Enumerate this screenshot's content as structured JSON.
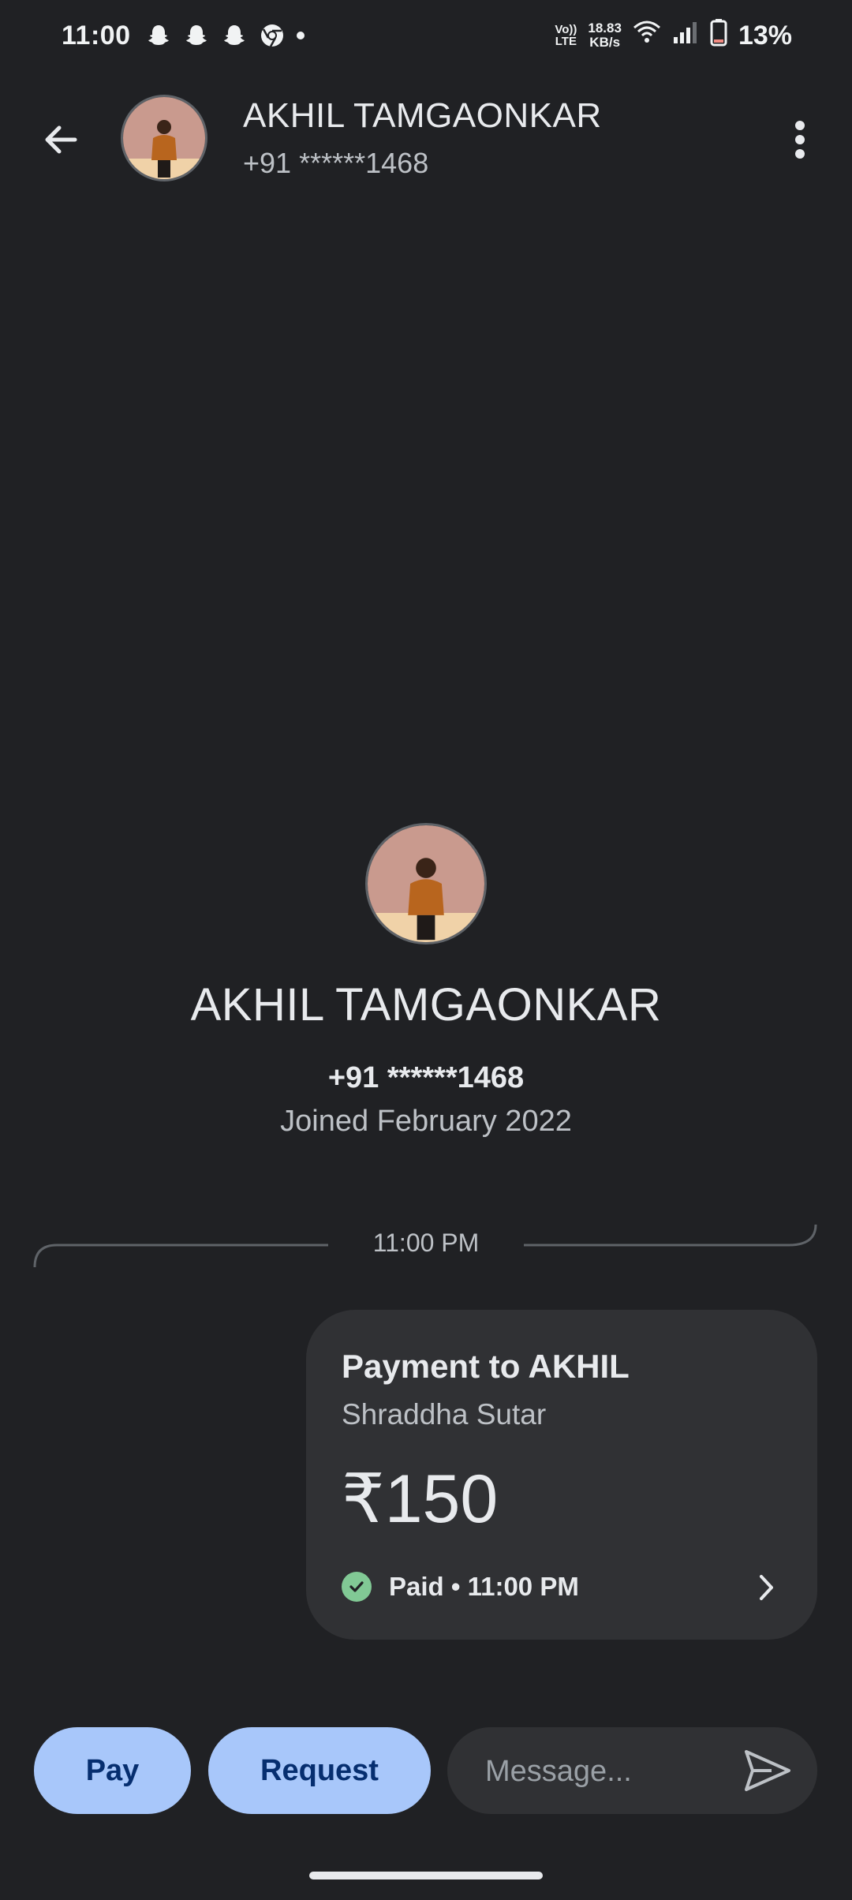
{
  "status_bar": {
    "time": "11:00",
    "notification_icons": [
      "snapchat-icon",
      "snapchat-icon",
      "snapchat-icon",
      "chrome-icon"
    ],
    "volte_label_top": "Vo))",
    "volte_label_bottom": "LTE",
    "net_speed_value": "18.83",
    "net_speed_unit": "KB/s",
    "battery_percent": "13%"
  },
  "header": {
    "name": "AKHIL TAMGAONKAR",
    "phone": "+91 ******1468"
  },
  "profile": {
    "name": "AKHIL TAMGAONKAR",
    "phone": "+91 ******1468",
    "joined": "Joined February 2022"
  },
  "conversation": {
    "divider_time": "11:00 PM",
    "payment": {
      "title": "Payment to AKHIL",
      "subtitle": "Shraddha Sutar",
      "amount": "₹150",
      "status": "Paid • 11:00 PM"
    }
  },
  "actions": {
    "pay_label": "Pay",
    "request_label": "Request",
    "message_placeholder": "Message..."
  },
  "colors": {
    "background": "#202124",
    "card": "#303134",
    "button": "#a8c7fa",
    "button_text": "#062e6f",
    "paid_green": "#81c995"
  }
}
